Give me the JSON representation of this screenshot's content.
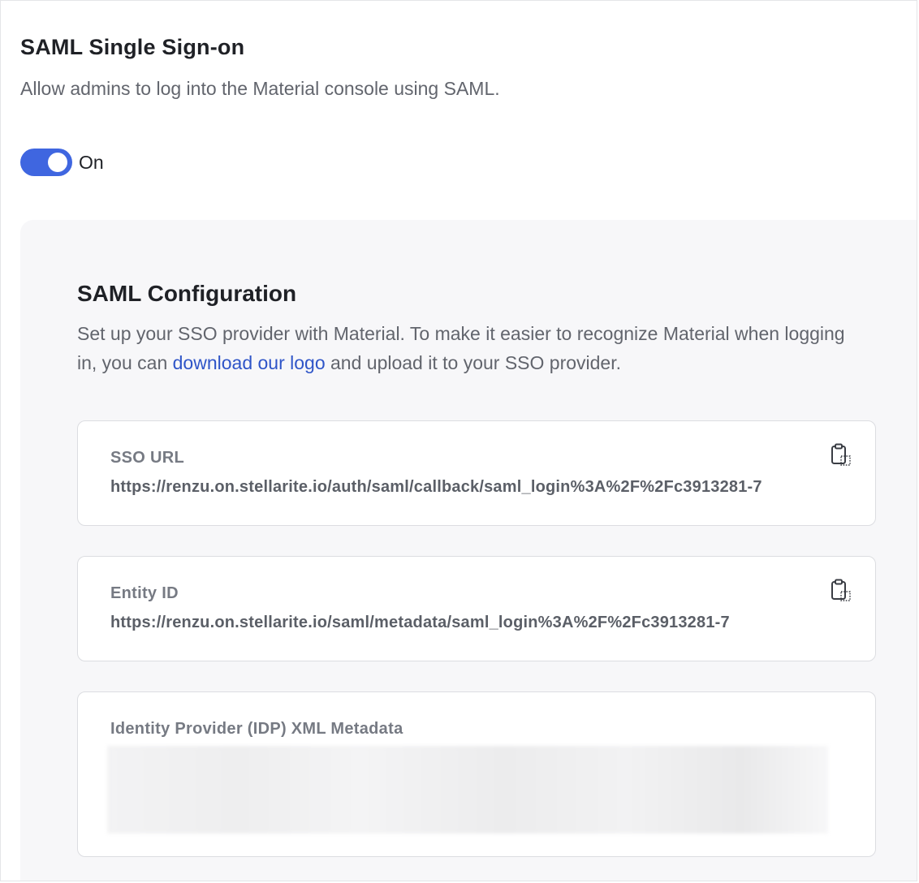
{
  "header": {
    "title": "SAML Single Sign-on",
    "subtitle": "Allow admins to log into the Material console using SAML."
  },
  "toggle": {
    "state_label": "On",
    "enabled": true,
    "accent_color": "#3f66e0"
  },
  "config": {
    "title": "SAML Configuration",
    "desc_before": "Set up your SSO provider with Material. To make it easier to recognize Material when logging in, you can ",
    "desc_link": "download our logo",
    "desc_after": " and upload it to your SSO provider.",
    "link_color": "#2f55c8",
    "fields": [
      {
        "label": "SSO URL",
        "value": "https://renzu.on.stellarite.io/auth/saml/callback/saml_login%3A%2F%2Fc3913281-7",
        "icon": "clipboard-copy-icon"
      },
      {
        "label": "Entity ID",
        "value": "https://renzu.on.stellarite.io/saml/metadata/saml_login%3A%2F%2Fc3913281-7",
        "icon": "clipboard-copy-icon"
      },
      {
        "label": "Identity Provider (IDP) XML Metadata"
      }
    ]
  }
}
